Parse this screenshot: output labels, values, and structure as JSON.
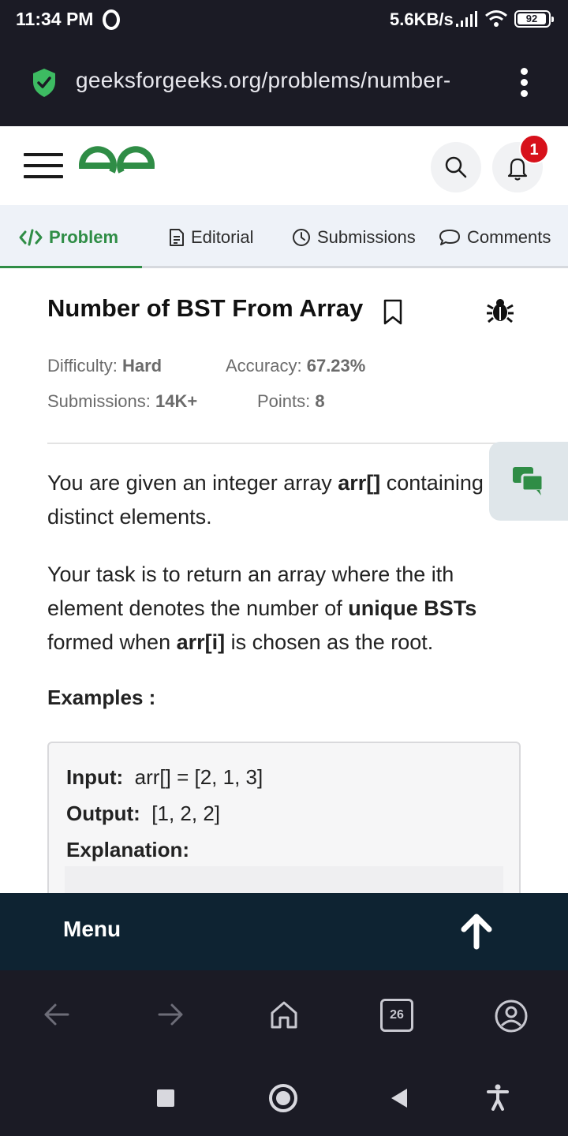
{
  "status_bar": {
    "time": "11:34 PM",
    "network_speed": "5.6KB/s",
    "battery": "92"
  },
  "browser": {
    "url": "geeksforgeeks.org/problems/number-",
    "tab_count": "26"
  },
  "site_header": {
    "notification_count": "1"
  },
  "tabs": [
    {
      "label": "Problem",
      "icon": "code-icon",
      "active": true
    },
    {
      "label": "Editorial",
      "icon": "document-icon",
      "active": false
    },
    {
      "label": "Submissions",
      "icon": "clock-icon",
      "active": false
    },
    {
      "label": "Comments",
      "icon": "comment-icon",
      "active": false
    }
  ],
  "problem": {
    "title": "Number of BST From Array",
    "difficulty_label": "Difficulty:",
    "difficulty": "Hard",
    "accuracy_label": "Accuracy:",
    "accuracy": "67.23%",
    "submissions_label": "Submissions:",
    "submissions": "14K+",
    "points_label": "Points:",
    "points": "8",
    "para1_a": "You are given an integer array ",
    "para1_b": "arr[]",
    "para1_c": " containing distinct elements.",
    "para2_a": "Your task is to return an array where the ith element denotes the number of ",
    "para2_b": "unique BSTs",
    "para2_c": " formed when ",
    "para2_d": "arr[i]",
    "para2_e": " is chosen as the root.",
    "examples_heading": "Examples :",
    "example": {
      "input_label": "Input:",
      "input_value": "arr[]  =  [2,  1,  3]",
      "output_label": "Output:",
      "output_value": "[1,  2,  2]",
      "explanation_label": "Explanation:"
    }
  },
  "menu_bar": {
    "label": "Menu"
  },
  "colors": {
    "brand_green": "#2f8d46",
    "badge_red": "#d7111b",
    "menu_bar_bg": "#0e2332",
    "browser_chrome": "#1b1b25"
  }
}
